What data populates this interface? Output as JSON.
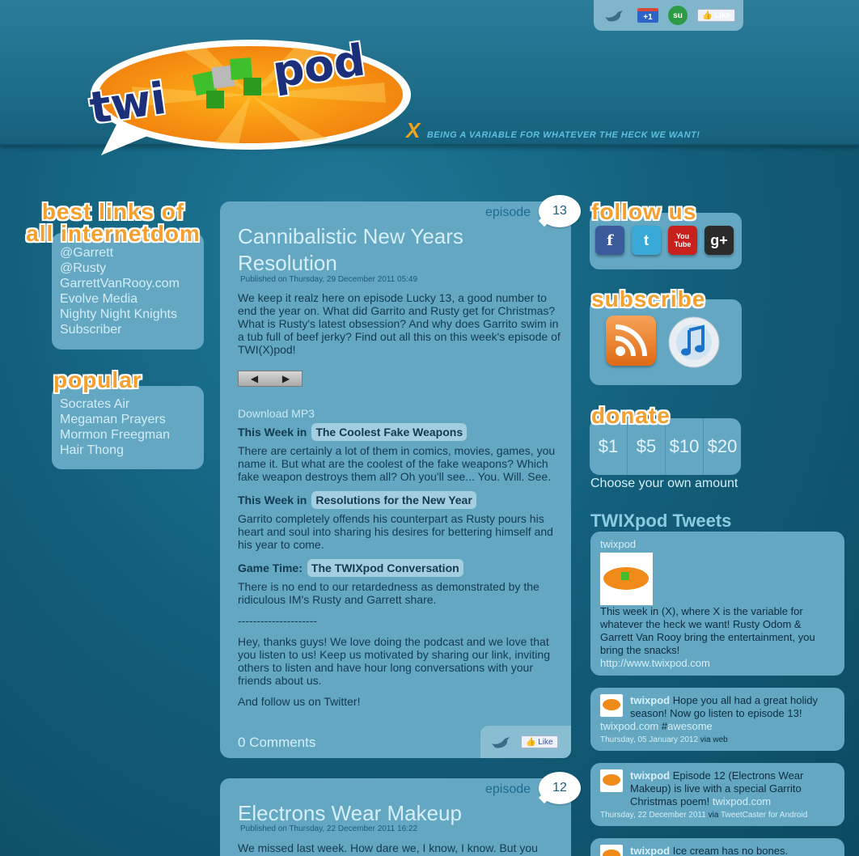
{
  "header": {
    "share_like": "Like",
    "share_plus": "+1",
    "tagline_x": "X",
    "tagline": "BEING A VARIABLE FOR WHATEVER THE HECK WE WANT!"
  },
  "logo": {
    "text_left": "twi",
    "text_right": "pod"
  },
  "left": {
    "best_links_title": [
      "best links of",
      "all internetdom"
    ],
    "best_links": [
      "@Garrett",
      "@Rusty",
      "GarrettVanRooy.com",
      "Evolve Media",
      "Nighty Night Knights",
      "Subscriber"
    ],
    "popular_title": "popular",
    "popular": [
      "Socrates Air",
      "Megaman Prayers",
      "Mormon Freegman",
      "Hair Thong"
    ]
  },
  "articles": [
    {
      "episode_label": "episode",
      "episode_number": "13",
      "title": "Cannibalistic New Years Resolution",
      "date": "Published on Thursday, 29 December 2011 05:49",
      "intro": "We keep it realz here on episode Lucky 13, a good number to end the year on. What did Garrito and Rusty get for Christmas? What is Rusty's latest obsession? And why does Garrito swim in a tub full of beef jerky? Find out all this on this week's episode of TWI(X)pod!",
      "download": "Download MP3",
      "segments": [
        {
          "prefix": "This Week in",
          "title": "The Coolest Fake Weapons",
          "text": "There are certainly a lot of them in comics, movies, games, you name it. But what are the coolest of the fake weapons? Which fake weapon destroys them all? Oh you'll see... You. Will. See."
        },
        {
          "prefix": "This Week in",
          "title": "Resolutions for the New Year",
          "text": "Garrito completely offends his counterpart as Rusty pours his heart and soul into sharing his desires for bettering himself and his year to come."
        },
        {
          "prefix": "Game Time:",
          "title": "The TWIXpod Conversation",
          "text": "There is no end to our retardedness as demonstrated by the ridiculous IM's Rusty and Garrett share."
        }
      ],
      "divider": "---------------------",
      "outro": "Hey, thanks guys! We love doing the podcast and we love that you listen to us! Keep us motivated by sharing our link, inviting others to listen and have hour long conversations with your friends about us.",
      "follow": "And follow us on Twitter!",
      "comments": "0 Comments",
      "like": "Like"
    },
    {
      "episode_label": "episode",
      "episode_number": "12",
      "title": "Electrons Wear Makeup",
      "date": "Published on Thursday, 22 December 2011 16:22",
      "intro": "We missed last week. How dare we, I know, I know. But you"
    }
  ],
  "right": {
    "follow_title": "follow us",
    "social": [
      {
        "icon": "facebook-icon",
        "glyph": "f",
        "color": "#3b5b9a"
      },
      {
        "icon": "twitter-icon",
        "glyph": "t",
        "color": "#39a9d8"
      },
      {
        "icon": "youtube-icon",
        "glyph": "You Tube",
        "color": "#c8201d"
      },
      {
        "icon": "google-plus-icon",
        "glyph": "g+",
        "color": "#2b2b2b"
      }
    ],
    "subscribe_title": "subscribe",
    "donate_title": "donate",
    "donate_amounts": [
      "$1",
      "$5",
      "$10",
      "$20"
    ],
    "choose_amount": "Choose your own amount",
    "tweets_heading": "TWIXpod Tweets",
    "profile": {
      "name": "twixpod",
      "bio": "This week in (X), where X is the variable for whatever the heck we want! Rusty Odom & Garrett Van Rooy bring the entertainment, you bring the snacks!",
      "url": "http://www.twixpod.com"
    },
    "tweets": [
      {
        "user": "twixpod",
        "text": "Hope you all had a great holidy season! Now go listen to episode 13!",
        "link": "twixpod.com",
        "tag_prefix": "#",
        "tag": "awesome",
        "date": "Thursday, 05 January 2012",
        "via": "via",
        "source": "web"
      },
      {
        "user": "twixpod",
        "text": "Episode 12 (Electrons Wear Makeup) is live with a special Garrito Christmas poem!",
        "link": "twixpod.com",
        "date": "Thursday, 22 December 2011",
        "via": "via",
        "source": "TweetCaster for Android"
      },
      {
        "user": "twixpod",
        "text": "Ice cream has no bones."
      }
    ]
  },
  "colors": {
    "panel": "#63a7c3",
    "accent_orange": "#f5a02e",
    "background": "#13607c"
  }
}
